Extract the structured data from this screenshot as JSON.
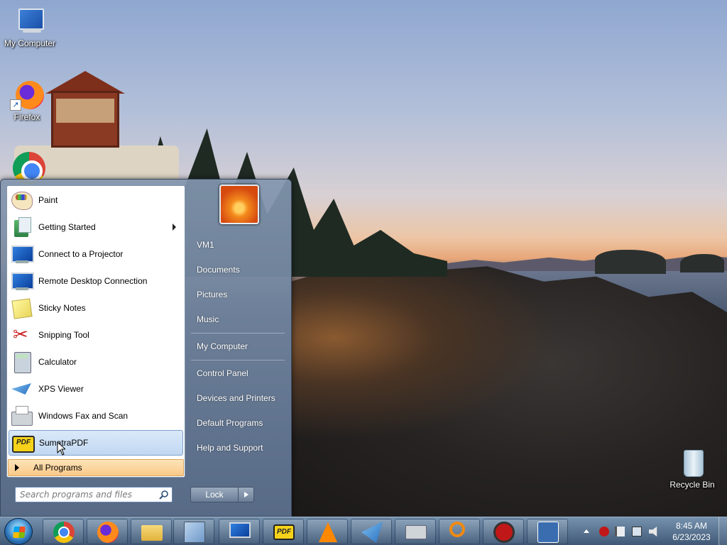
{
  "desktop": {
    "icons": [
      {
        "label": "My Computer",
        "icon": "computer-icon"
      },
      {
        "label": "Firefox",
        "icon": "firefox-icon"
      },
      {
        "label": "",
        "icon": "chrome-icon"
      },
      {
        "label": "Recycle Bin",
        "icon": "recycle-bin-icon"
      }
    ]
  },
  "start_menu": {
    "programs": [
      {
        "label": "Paint",
        "icon": "paint-icon"
      },
      {
        "label": "Getting Started",
        "icon": "getting-started-icon",
        "submenu": true
      },
      {
        "label": "Connect to a Projector",
        "icon": "projector-icon"
      },
      {
        "label": "Remote Desktop Connection",
        "icon": "remote-desktop-icon"
      },
      {
        "label": "Sticky Notes",
        "icon": "sticky-notes-icon"
      },
      {
        "label": "Snipping Tool",
        "icon": "snipping-tool-icon"
      },
      {
        "label": "Calculator",
        "icon": "calculator-icon"
      },
      {
        "label": "XPS Viewer",
        "icon": "xps-viewer-icon"
      },
      {
        "label": "Windows Fax and Scan",
        "icon": "fax-scan-icon"
      },
      {
        "label": "SumatraPDF",
        "icon": "sumatrapdf-icon",
        "highlighted": true
      }
    ],
    "all_programs_label": "All Programs",
    "search_placeholder": "Search programs and files",
    "right_links": [
      {
        "label": "VM1"
      },
      {
        "label": "Documents"
      },
      {
        "label": "Pictures"
      },
      {
        "label": "Music"
      },
      {
        "label": "My Computer"
      },
      {
        "label": "Control Panel"
      },
      {
        "label": "Devices and Printers"
      },
      {
        "label": "Default Programs"
      },
      {
        "label": "Help and Support"
      }
    ],
    "lock_label": "Lock"
  },
  "taskbar": {
    "pinned": [
      "chrome-icon",
      "firefox-icon",
      "file-explorer-icon",
      "control-panel-icon",
      "remote-desktop-icon",
      "sumatrapdf-icon",
      "vlc-icon",
      "xps-viewer-icon",
      "fax-scan-icon",
      "search-tool-icon",
      "red-app-icon",
      "sync-app-icon"
    ],
    "pdf_text": "PDF",
    "clock": {
      "time": "8:45 AM",
      "date": "6/23/2023"
    }
  }
}
